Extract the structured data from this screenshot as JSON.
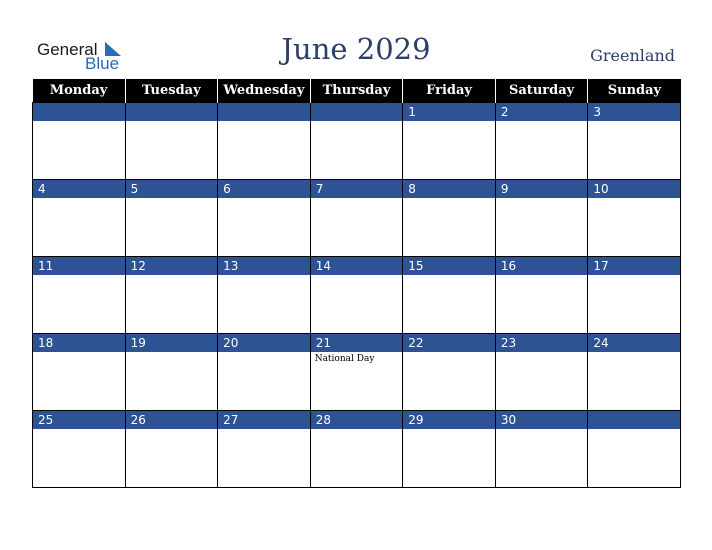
{
  "logo": {
    "text1": "General",
    "text2": "Blue"
  },
  "title": "June 2029",
  "region": "Greenland",
  "weekdays": [
    "Monday",
    "Tuesday",
    "Wednesday",
    "Thursday",
    "Friday",
    "Saturday",
    "Sunday"
  ],
  "weeks": [
    [
      {
        "d": ""
      },
      {
        "d": ""
      },
      {
        "d": ""
      },
      {
        "d": ""
      },
      {
        "d": "1"
      },
      {
        "d": "2"
      },
      {
        "d": "3"
      }
    ],
    [
      {
        "d": "4"
      },
      {
        "d": "5"
      },
      {
        "d": "6"
      },
      {
        "d": "7"
      },
      {
        "d": "8"
      },
      {
        "d": "9"
      },
      {
        "d": "10"
      }
    ],
    [
      {
        "d": "11"
      },
      {
        "d": "12"
      },
      {
        "d": "13"
      },
      {
        "d": "14"
      },
      {
        "d": "15"
      },
      {
        "d": "16"
      },
      {
        "d": "17"
      }
    ],
    [
      {
        "d": "18"
      },
      {
        "d": "19"
      },
      {
        "d": "20"
      },
      {
        "d": "21",
        "e": "National Day"
      },
      {
        "d": "22"
      },
      {
        "d": "23"
      },
      {
        "d": "24"
      }
    ],
    [
      {
        "d": "25"
      },
      {
        "d": "26"
      },
      {
        "d": "27"
      },
      {
        "d": "28"
      },
      {
        "d": "29"
      },
      {
        "d": "30"
      },
      {
        "d": ""
      }
    ]
  ]
}
